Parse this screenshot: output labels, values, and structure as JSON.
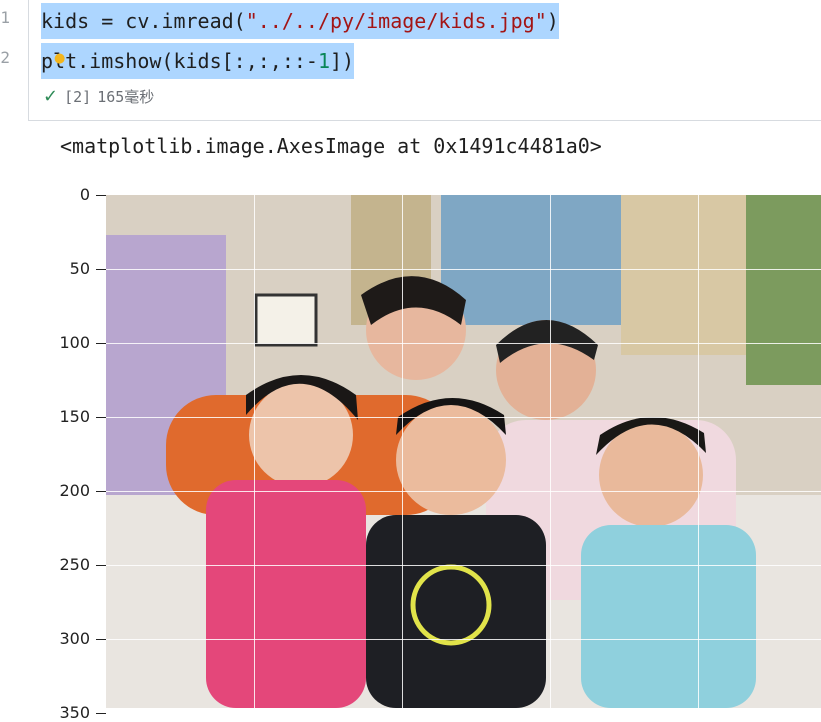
{
  "editor": {
    "line_numbers": [
      "1",
      "2"
    ],
    "code_line_1": {
      "pre": "kids = cv.imread(",
      "string": "\"../../py/image/kids.jpg\"",
      "post": ")"
    },
    "code_line_2": {
      "pre": "plt.imshow(kids[:,:,::-",
      "number": "1",
      "post": "])"
    },
    "status": {
      "exec_count": "[2]",
      "duration": "165毫秒"
    }
  },
  "output": {
    "repr": "<matplotlib.image.AxesImage at 0x1491c4481a0>"
  },
  "chart_data": {
    "type": "image",
    "yticks": [
      "0",
      "50",
      "100",
      "150",
      "200",
      "250",
      "300",
      "350"
    ],
    "grid": true,
    "image_description_tag": "family photo (kids.jpg)"
  },
  "colors": {
    "selection": "#add6ff",
    "string": "#a31515",
    "number": "#098658",
    "success": "#2e8b57"
  }
}
